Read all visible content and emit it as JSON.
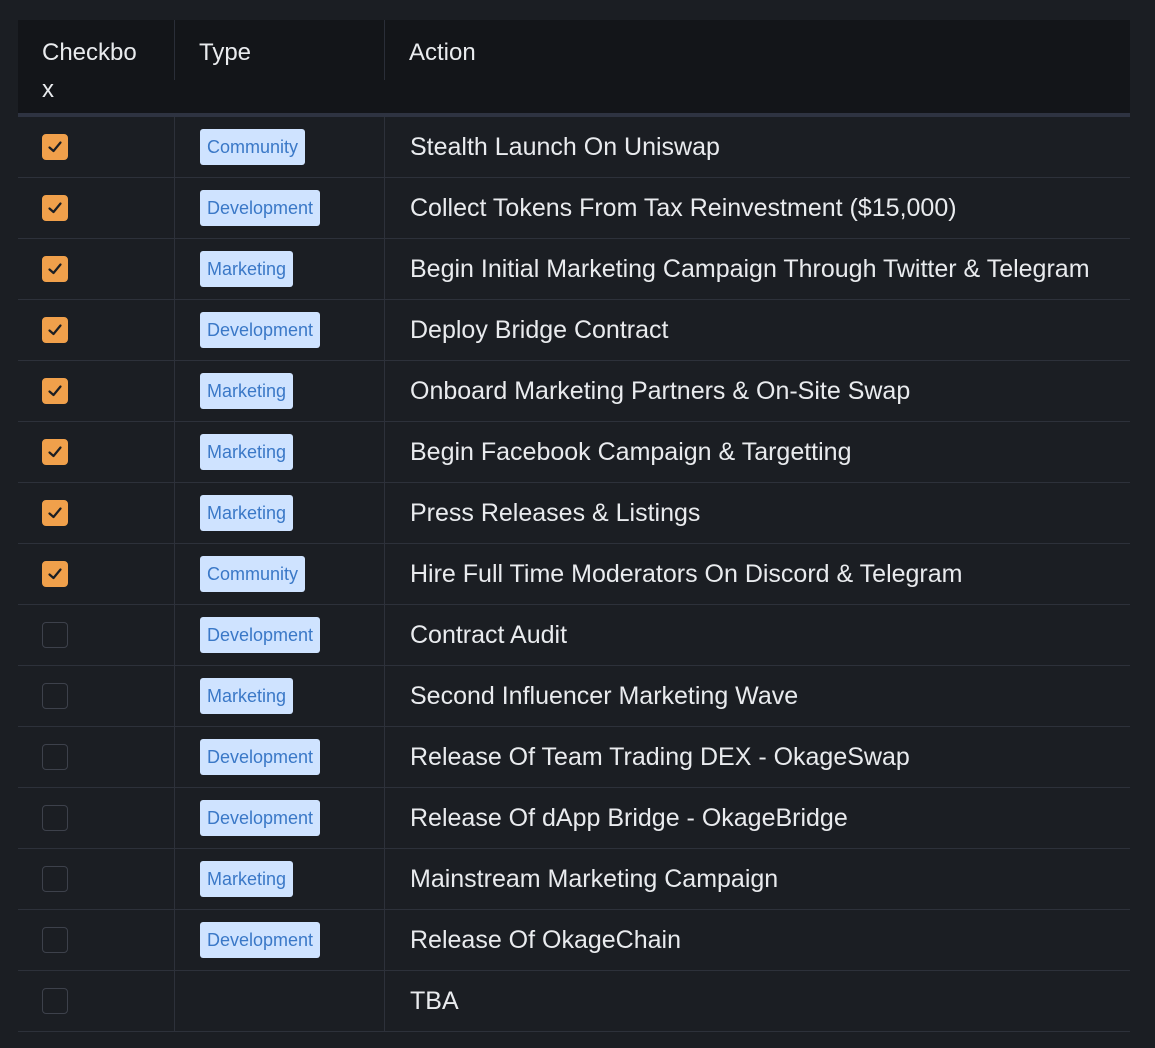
{
  "header": {
    "checkbox": "Checkbox",
    "type": "Type",
    "action": "Action"
  },
  "colors": {
    "checked": "#f0a04b",
    "tag_bg": "#cfe3ff",
    "tag_text": "#3a78c7"
  },
  "rows": [
    {
      "checked": true,
      "type": "Community",
      "action": "Stealth Launch On Uniswap"
    },
    {
      "checked": true,
      "type": "Development",
      "action": "Collect Tokens From Tax Reinvestment ($15,000)"
    },
    {
      "checked": true,
      "type": "Marketing",
      "action": "Begin Initial Marketing Campaign Through Twitter & Telegram"
    },
    {
      "checked": true,
      "type": "Development",
      "action": "Deploy Bridge Contract"
    },
    {
      "checked": true,
      "type": "Marketing",
      "action": "Onboard Marketing Partners & On-Site Swap"
    },
    {
      "checked": true,
      "type": "Marketing",
      "action": "Begin Facebook Campaign & Targetting"
    },
    {
      "checked": true,
      "type": "Marketing",
      "action": "Press Releases & Listings"
    },
    {
      "checked": true,
      "type": "Community",
      "action": "Hire Full Time Moderators On Discord & Telegram"
    },
    {
      "checked": false,
      "type": "Development",
      "action": "Contract Audit"
    },
    {
      "checked": false,
      "type": "Marketing",
      "action": "Second Influencer Marketing Wave"
    },
    {
      "checked": false,
      "type": "Development",
      "action": "Release Of Team Trading DEX - OkageSwap"
    },
    {
      "checked": false,
      "type": "Development",
      "action": "Release Of dApp Bridge - OkageBridge"
    },
    {
      "checked": false,
      "type": "Marketing",
      "action": "Mainstream Marketing Campaign"
    },
    {
      "checked": false,
      "type": "Development",
      "action": "Release Of OkageChain"
    },
    {
      "checked": false,
      "type": "",
      "action": "TBA"
    }
  ]
}
